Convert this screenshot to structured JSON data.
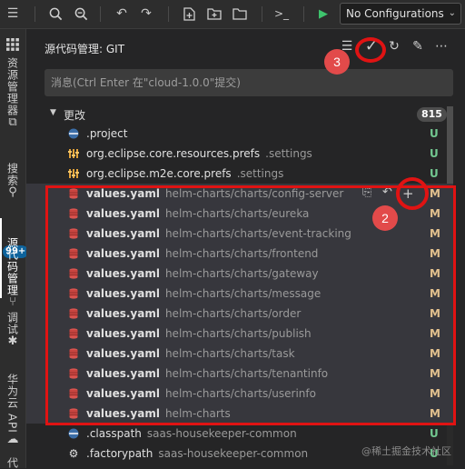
{
  "toolbar": {
    "config_select_value": "No Configurations"
  },
  "activity_bar": {
    "explorer_label": "资源管理器",
    "search_label": "搜索",
    "scm_label": "源代码管理",
    "scm_badge": "99+",
    "debug_label": "调试",
    "cloud_label": "华为云 API",
    "last_label": "代"
  },
  "panel": {
    "title": "源代码管理: GIT",
    "commit_placeholder": "消息(Ctrl Enter 在\"cloud-1.0.0\"提交)",
    "group_label": "更改",
    "group_count": "815"
  },
  "files": [
    {
      "name": ".project",
      "path": "",
      "status": "U",
      "icon": "eclipse-file-icon"
    },
    {
      "name": "org.eclipse.core.resources.prefs",
      "path": ".settings",
      "status": "U",
      "icon": "settings-file-icon"
    },
    {
      "name": "org.eclipse.m2e.core.prefs",
      "path": ".settings",
      "status": "U",
      "icon": "settings-file-icon"
    },
    {
      "name": "values.yaml",
      "path": "helm-charts/charts/config-server",
      "status": "M",
      "icon": "yaml-file-icon"
    },
    {
      "name": "values.yaml",
      "path": "helm-charts/charts/eureka",
      "status": "M",
      "icon": "yaml-file-icon"
    },
    {
      "name": "values.yaml",
      "path": "helm-charts/charts/event-tracking",
      "status": "M",
      "icon": "yaml-file-icon"
    },
    {
      "name": "values.yaml",
      "path": "helm-charts/charts/frontend",
      "status": "M",
      "icon": "yaml-file-icon"
    },
    {
      "name": "values.yaml",
      "path": "helm-charts/charts/gateway",
      "status": "M",
      "icon": "yaml-file-icon"
    },
    {
      "name": "values.yaml",
      "path": "helm-charts/charts/message",
      "status": "M",
      "icon": "yaml-file-icon"
    },
    {
      "name": "values.yaml",
      "path": "helm-charts/charts/order",
      "status": "M",
      "icon": "yaml-file-icon"
    },
    {
      "name": "values.yaml",
      "path": "helm-charts/charts/publish",
      "status": "M",
      "icon": "yaml-file-icon"
    },
    {
      "name": "values.yaml",
      "path": "helm-charts/charts/task",
      "status": "M",
      "icon": "yaml-file-icon"
    },
    {
      "name": "values.yaml",
      "path": "helm-charts/charts/tenantinfo",
      "status": "M",
      "icon": "yaml-file-icon"
    },
    {
      "name": "values.yaml",
      "path": "helm-charts/charts/userinfo",
      "status": "M",
      "icon": "yaml-file-icon"
    },
    {
      "name": "values.yaml",
      "path": "helm-charts",
      "status": "M",
      "icon": "yaml-file-icon"
    },
    {
      "name": ".classpath",
      "path": "saas-housekeeper-common",
      "status": "U",
      "icon": "eclipse-file-icon"
    },
    {
      "name": ".factorypath",
      "path": "saas-housekeeper-common",
      "status": "U",
      "icon": "gear-file-icon"
    }
  ],
  "annotations": {
    "n1": "2",
    "n2": "3"
  },
  "watermark": "@稀土掘金技术社区",
  "colors": {
    "accent_red": "#e01313",
    "untracked": "#73c991",
    "modified": "#e2c08d"
  }
}
